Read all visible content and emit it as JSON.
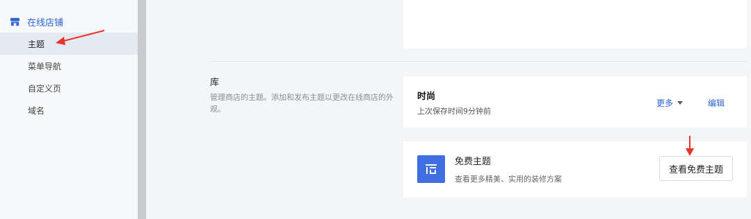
{
  "sidebar": {
    "store_label": "在线店铺",
    "items": [
      {
        "label": "主题",
        "active": true
      },
      {
        "label": "菜单导航",
        "active": false
      },
      {
        "label": "自定义页",
        "active": false
      },
      {
        "label": "域名",
        "active": false
      }
    ],
    "store_icon": "store-icon"
  },
  "library": {
    "title": "库",
    "description": "管理商店的主题。添加和发布主题以更改在线商店的外观。"
  },
  "current_theme": {
    "name": "时尚",
    "saved": "上次保存时间9分钟前",
    "more_label": "更多",
    "edit_label": "编辑"
  },
  "free_themes": {
    "title": "免费主题",
    "description": "查看更多精美、实用的装修方案",
    "button_label": "查看免费主题",
    "icon": "theme-layout-icon"
  },
  "colors": {
    "accent": "#2f64d6",
    "icon_bg": "#3f6fe0",
    "annotation": "#e8322a"
  }
}
